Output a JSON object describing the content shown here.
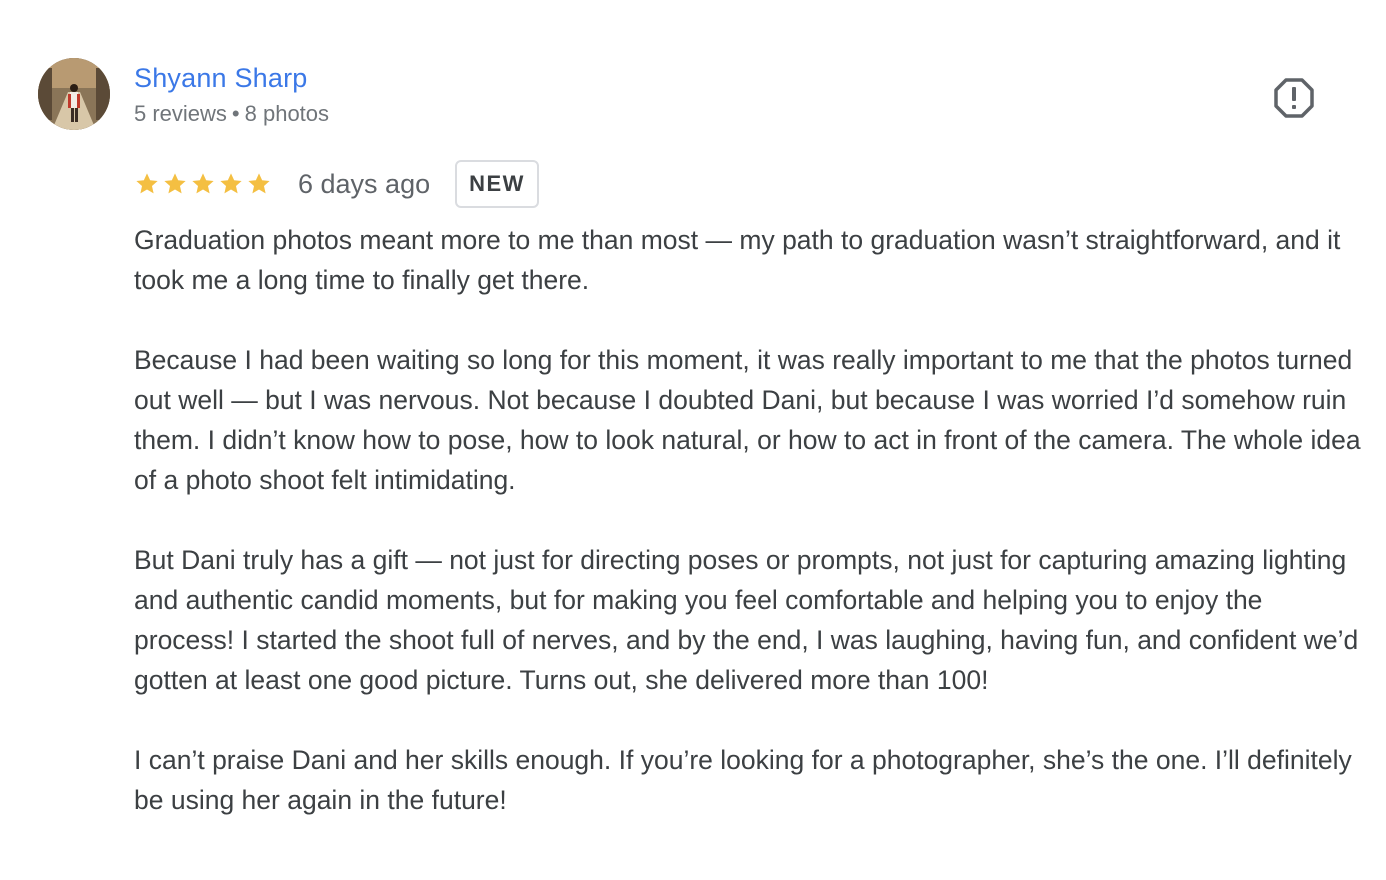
{
  "reviewer": {
    "name": "Shyann Sharp",
    "reviews": "5 reviews",
    "separator": "•",
    "photos": "8 photos"
  },
  "review": {
    "rating": 5,
    "max_rating": 5,
    "date": "6 days ago",
    "badge": "NEW",
    "paragraphs": [
      "Graduation photos meant more to me than most — my path to graduation wasn’t straightforward, and it took me a long time to finally get there.",
      "Because I had been waiting so long for this moment, it was really important to me that the photos turned out well — but I was nervous. Not because I doubted Dani, but because I was worried I’d somehow ruin them. I didn’t know how to pose, how to look natural, or how to act in front of the camera. The whole idea of a photo shoot felt intimidating.",
      "But Dani truly has a gift — not just for directing poses or prompts, not just for capturing amazing lighting and authentic candid moments, but for making you feel comfortable and helping you to enjoy the process! I started the shoot full of nerves, and by the end, I was laughing, having fun, and confident we’d gotten at least one good picture. Turns out, she delivered more than 100!",
      "I can’t praise Dani and her skills enough. If you’re looking for a photographer, she’s the one. I’ll definitely be using her again in the future!"
    ]
  },
  "icons": {
    "report": "report-flag-icon",
    "star": "star-icon"
  },
  "colors": {
    "name_link": "#3b78e7",
    "star": "#f4bf42",
    "meta": "#70757a",
    "text": "#3c4043",
    "badge_border": "#dadce0",
    "report_icon": "#5f6368"
  }
}
